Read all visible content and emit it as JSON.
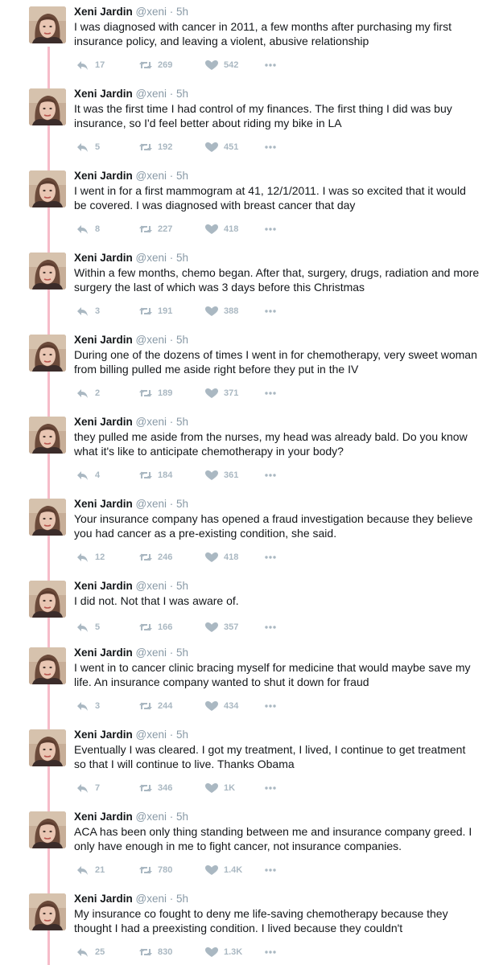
{
  "colors": {
    "thread_line": "#f6bcc9",
    "muted": "#8899a6",
    "action": "#aab8c2",
    "text": "#14171a"
  },
  "icons": {
    "reply": "reply-icon",
    "retweet": "retweet-icon",
    "like": "heart-icon",
    "more": "more-icon",
    "avatar": "avatar"
  },
  "tweets": [
    {
      "name": "Xeni Jardin",
      "meta": "@xeni · 5h",
      "text": "I was diagnosed with cancer in 2011, a few months after purchasing my first insurance policy, and leaving a violent, abusive relationship",
      "replies": "17",
      "retweets": "269",
      "likes": "542"
    },
    {
      "name": "Xeni Jardin",
      "meta": "@xeni · 5h",
      "text": "It was the first time I had control of my finances. The first thing I did was buy insurance, so I'd feel better about riding my bike in LA",
      "replies": "5",
      "retweets": "192",
      "likes": "451"
    },
    {
      "name": "Xeni Jardin",
      "meta": "@xeni · 5h",
      "text": "I went in for a first mammogram at 41, 12/1/2011. I was so excited that it would be covered. I was diagnosed with breast cancer that day",
      "replies": "8",
      "retweets": "227",
      "likes": "418"
    },
    {
      "name": "Xeni Jardin",
      "meta": "@xeni · 5h",
      "text": "Within a few months, chemo began. After that, surgery, drugs, radiation and more surgery the last of which was 3 days before this Christmas",
      "replies": "3",
      "retweets": "191",
      "likes": "388"
    },
    {
      "name": "Xeni Jardin",
      "meta": "@xeni · 5h",
      "text": "During one of the dozens of times I went in for chemotherapy, very sweet woman from billing pulled me aside right before they put in the IV",
      "replies": "2",
      "retweets": "189",
      "likes": "371"
    },
    {
      "name": "Xeni Jardin",
      "meta": "@xeni · 5h",
      "text": "they pulled me aside from the nurses, my head was already bald. Do you know what it's like to anticipate chemotherapy in your body?",
      "replies": "4",
      "retweets": "184",
      "likes": "361"
    },
    {
      "name": "Xeni Jardin",
      "meta": "@xeni · 5h",
      "text": "Your insurance company has opened a fraud investigation because they believe you had cancer as a pre-existing condition, she said.",
      "replies": "12",
      "retweets": "246",
      "likes": "418"
    },
    {
      "name": "Xeni Jardin",
      "meta": "@xeni · 5h",
      "text": "I did not. Not that I was aware of.",
      "replies": "5",
      "retweets": "166",
      "likes": "357"
    },
    {
      "name": "Xeni Jardin",
      "meta": "@xeni · 5h",
      "text": "I went in to cancer clinic bracing myself for medicine that would maybe save my life. An insurance company wanted to shut it down for fraud",
      "replies": "3",
      "retweets": "244",
      "likes": "434"
    },
    {
      "name": "Xeni Jardin",
      "meta": "@xeni · 5h",
      "text": "Eventually I was cleared. I got my treatment, I lived, I continue to get treatment so that I will continue to live. Thanks Obama",
      "replies": "7",
      "retweets": "346",
      "likes": "1K"
    },
    {
      "name": "Xeni Jardin",
      "meta": "@xeni · 5h",
      "text": "ACA has been only thing standing between me and insurance company greed. I only have enough in me to fight cancer, not insurance companies.",
      "replies": "21",
      "retweets": "780",
      "likes": "1.4K"
    },
    {
      "name": "Xeni Jardin",
      "meta": "@xeni · 5h",
      "text": "My insurance co fought to deny me life-saving chemotherapy because they thought I had a preexisting condition. I lived because they couldn't",
      "replies": "25",
      "retweets": "830",
      "likes": "1.3K"
    }
  ]
}
